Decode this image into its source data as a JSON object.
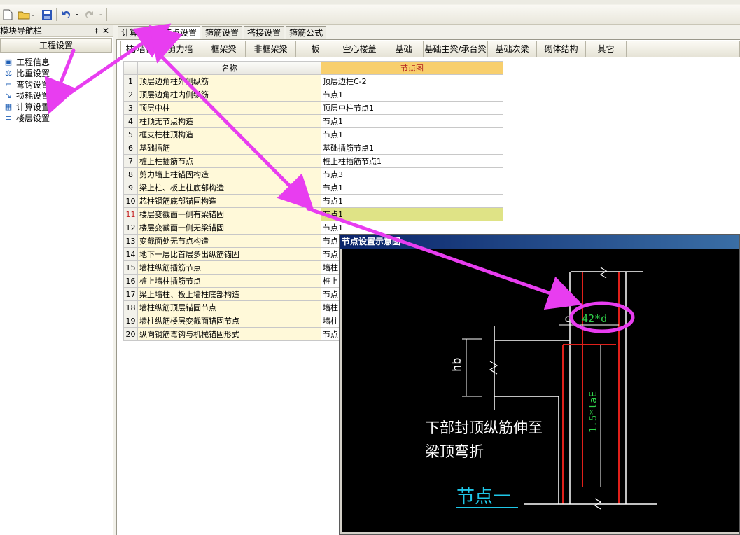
{
  "menu_strip": [
    "…"
  ],
  "toolbar": {
    "new_icon": "new-file-icon",
    "open_icon": "open-folder-icon",
    "save_icon": "save-disk-icon",
    "undo_icon": "undo-icon",
    "redo_icon": "redo-icon"
  },
  "nav": {
    "title": "模块导航栏",
    "pin": "‡",
    "close": "✕",
    "section": "工程设置",
    "items": [
      {
        "label": "工程信息",
        "icon": "info-icon"
      },
      {
        "label": "比重设置",
        "icon": "weight-icon"
      },
      {
        "label": "弯钩设置",
        "icon": "hook-icon"
      },
      {
        "label": "损耗设置",
        "icon": "loss-icon"
      },
      {
        "label": "计算设置",
        "icon": "calc-icon"
      },
      {
        "label": "楼层设置",
        "icon": "floor-icon"
      }
    ]
  },
  "tabs": [
    {
      "label": "计算设置"
    },
    {
      "label": "节点设置"
    },
    {
      "label": "箍筋设置"
    },
    {
      "label": "搭接设置"
    },
    {
      "label": "箍筋公式"
    }
  ],
  "categories": [
    "柱/墙柱",
    "剪力墙",
    "框架梁",
    "非框架梁",
    "板",
    "空心楼盖",
    "基础",
    "基础主梁/承台梁",
    "基础次梁",
    "砌体结构",
    "其它"
  ],
  "table": {
    "col_name": "名称",
    "col_node": "节点图",
    "rows": [
      {
        "idx": "1",
        "name": "顶层边角柱外侧纵筋",
        "node": "顶层边柱C-2"
      },
      {
        "idx": "2",
        "name": "顶层边角柱内侧纵筋",
        "node": "节点1"
      },
      {
        "idx": "3",
        "name": "顶层中柱",
        "node": "顶层中柱节点1"
      },
      {
        "idx": "4",
        "name": "柱顶无节点构造",
        "node": "节点1"
      },
      {
        "idx": "5",
        "name": "框支柱柱顶构造",
        "node": "节点1"
      },
      {
        "idx": "6",
        "name": "基础插筋",
        "node": "基础插筋节点1"
      },
      {
        "idx": "7",
        "name": "桩上柱插筋节点",
        "node": "桩上柱插筋节点1"
      },
      {
        "idx": "8",
        "name": "剪力墙上柱锚固构造",
        "node": "节点3"
      },
      {
        "idx": "9",
        "name": "梁上柱、板上柱底部构造",
        "node": "节点1"
      },
      {
        "idx": "10",
        "name": "芯柱钢筋底部锚固构造",
        "node": "节点1"
      },
      {
        "idx": "11",
        "name": "楼层变截面一侧有梁锚固",
        "node": "节点1"
      },
      {
        "idx": "12",
        "name": "楼层变截面一侧无梁锚固",
        "node": "节点1"
      },
      {
        "idx": "13",
        "name": "变截面处无节点构造",
        "node": "节点"
      },
      {
        "idx": "14",
        "name": "地下一层比首层多出纵筋锚固",
        "node": "节点"
      },
      {
        "idx": "15",
        "name": "墙柱纵筋插筋节点",
        "node": "墙柱"
      },
      {
        "idx": "16",
        "name": "桩上墙柱插筋节点",
        "node": "桩上"
      },
      {
        "idx": "17",
        "name": "梁上墙柱、板上墙柱底部构造",
        "node": "节点"
      },
      {
        "idx": "18",
        "name": "墙柱纵筋顶层锚固节点",
        "node": "墙柱"
      },
      {
        "idx": "19",
        "name": "墙柱纵筋楼层变截面锚固节点",
        "node": "墙柱"
      },
      {
        "idx": "20",
        "name": "纵向钢筋弯钩与机械锚固形式",
        "node": "节点"
      }
    ]
  },
  "popup": {
    "title": "节点设置示意图",
    "label_c": "c",
    "label_42d": "42*d",
    "label_hb": "hb",
    "label_15lae": "1.5*laE",
    "note_line1": "下部封顶纵筋伸至",
    "note_line2": "梁顶弯折",
    "node_name": "节点一"
  },
  "colors": {
    "highlight_arrow": "#e83df0",
    "node_header": "#f8cf6d",
    "selected_row": "#dfe386",
    "rebar_red": "#e0201a",
    "dim_green": "#2fd14a",
    "caption_cyan": "#1fc7e8"
  }
}
